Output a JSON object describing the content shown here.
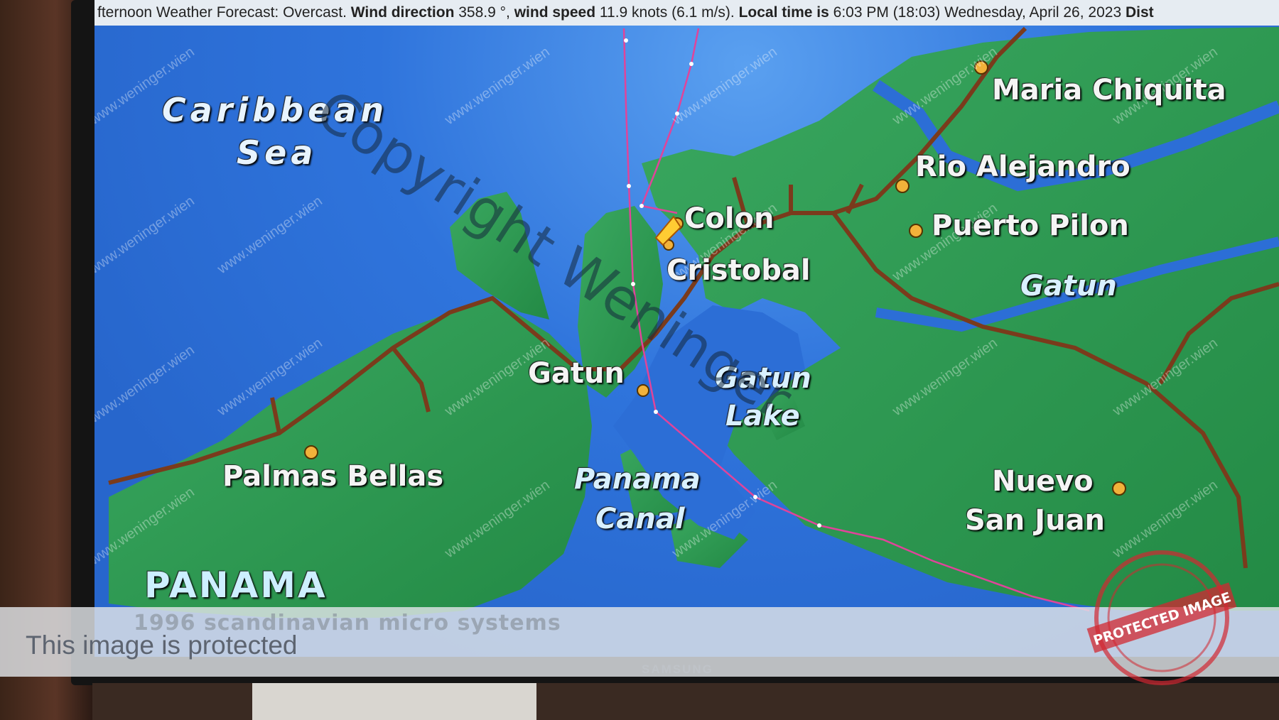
{
  "status_bar": {
    "lead": "fternoon Weather Forecast: Overcast. ",
    "wind_dir_label": "Wind direction",
    "wind_dir_value": " 358.9 °, ",
    "wind_speed_label": "wind speed",
    "wind_speed_value": " 11.9 knots (6.1 m/s). ",
    "time_label": "Local time is",
    "time_value": " 6:03 PM (18:03) ",
    "date": "Wednesday, April 26, 2023",
    "tail": " Dist"
  },
  "labels": {
    "caribbean_1": "Caribbean",
    "caribbean_2": "Sea",
    "maria_chiquita": "Maria Chiquita",
    "rio_alejandro": "Rio Alejandro",
    "puerto_pilon": "Puerto Pilon",
    "gatun_east": "Gatun",
    "colon": "Colon",
    "cristobal": "Cristobal",
    "gatun_town": "Gatun",
    "gatun_lake_1": "Gatun",
    "gatun_lake_2": "Lake",
    "panama_canal_1": "Panama",
    "panama_canal_2": "Canal",
    "palmas_bellas": "Palmas Bellas",
    "nuevo_1": "Nuevo",
    "nuevo_2": "San Juan",
    "panama": "PANAMA"
  },
  "overlay": {
    "copyright_watermark": "Copyright Weninger",
    "small_watermark": "www.weninger.wien",
    "protected_text": "This image is protected",
    "map_credit": "1996 scandinavian micro systems",
    "monitor_brand": "SAMSUNG",
    "stamp_text": "PROTECTED IMAGE"
  },
  "colors": {
    "sea": "#2f74dc",
    "land": "#2f9e55",
    "road": "#7a3b1c",
    "route": "#e0449a",
    "town_dot": "#f2b23a"
  }
}
